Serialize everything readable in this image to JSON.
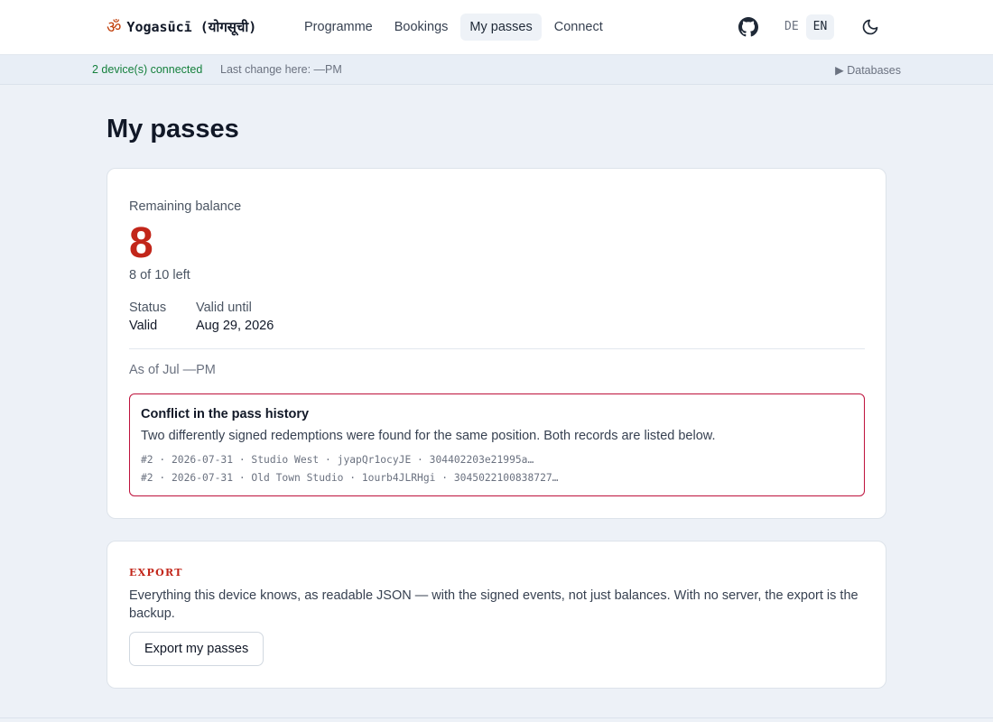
{
  "header": {
    "brand_symbol": "ॐ",
    "brand_name": "Yogasūcī (योगसूची)",
    "nav": [
      {
        "label": "Programme"
      },
      {
        "label": "Bookings"
      },
      {
        "label": "My passes",
        "active": true
      },
      {
        "label": "Connect"
      }
    ],
    "github_icon": "github-icon",
    "languages": [
      {
        "label": "DE"
      },
      {
        "label": "EN",
        "active": true
      }
    ],
    "theme_icon": "moon-icon"
  },
  "status": {
    "devices": "2 device(s) connected",
    "last_change": "Last change here: —PM",
    "databases": "▶ Databases"
  },
  "page": {
    "title": "My passes"
  },
  "balance_card": {
    "remaining_label": "Remaining balance",
    "remaining_value": "8",
    "remaining_detail": "8 of 10 left",
    "status_label": "Status",
    "status_value": "Valid",
    "valid_until_label": "Valid until",
    "valid_until_value": "Aug 29, 2026",
    "as_of": "As of Jul —PM",
    "conflict": {
      "title": "Conflict in the pass history",
      "description": "Two differently signed redemptions were found for the same position. Both records are listed below.",
      "records": [
        "#2 · 2026-07-31 · Studio West · jyapQr1ocyJE · 304402203e21995a…",
        "#2 · 2026-07-31 · Old Town Studio · 1ourb4JLRHgi · 3045022100838727…"
      ]
    }
  },
  "export_card": {
    "label": "EXPORT",
    "description": "Everything this device knows, as readable JSON — with the signed events, not just balances. With no server, the export is the backup.",
    "button_label": "Export my passes"
  },
  "colors": {
    "accent_red": "#c2261a",
    "conflict_border": "#be123c",
    "connected_green": "#15803d",
    "page_bg": "#edf1f7"
  }
}
